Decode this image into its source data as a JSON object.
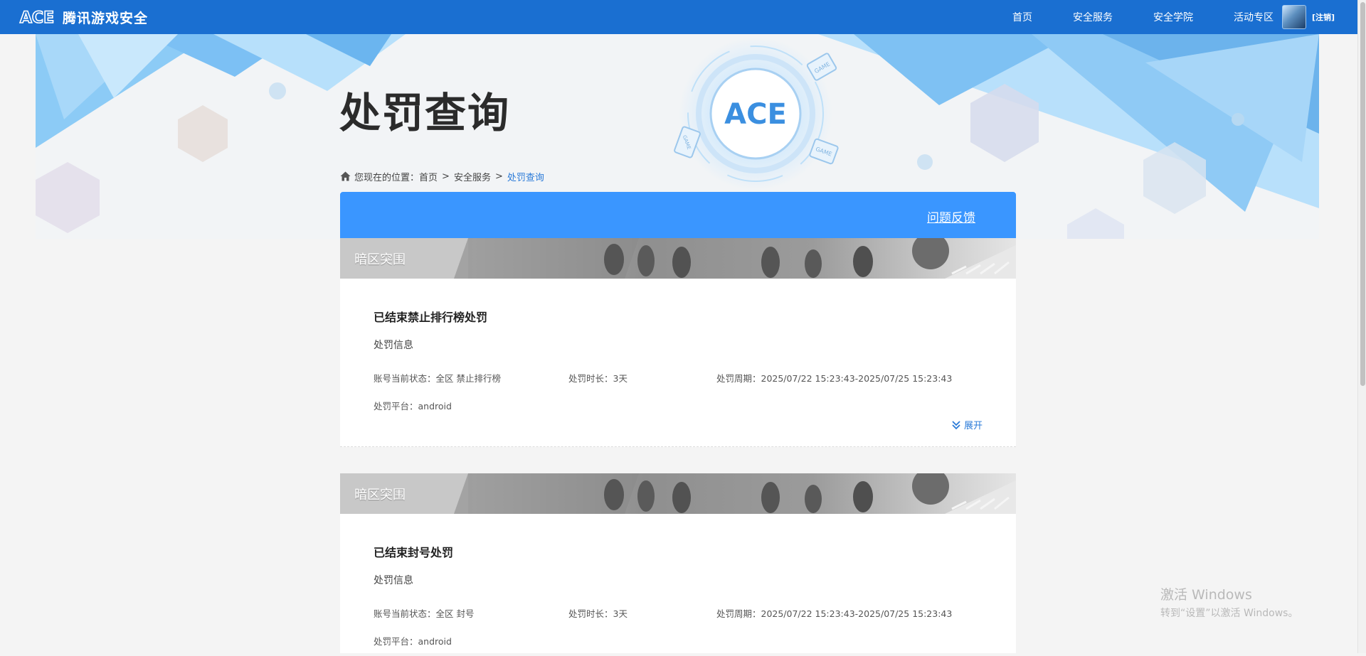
{
  "topbar": {
    "logo_mark": "ACE",
    "logo_text": "腾讯游戏安全",
    "nav": [
      "首页",
      "安全服务",
      "安全学院",
      "活动专区"
    ],
    "logout": "[注销]",
    "bg_color": "#1a6fd1"
  },
  "banner": {
    "emblem_text": "ACE",
    "game_badge": "GAME"
  },
  "page": {
    "title": "处罚查询",
    "breadcrumb": {
      "prefix": "您现在的位置：",
      "items": [
        "首页",
        "安全服务",
        "处罚查询"
      ],
      "separator": ">"
    }
  },
  "panel": {
    "feedback": "问题反馈",
    "header_color": "#3a96ff"
  },
  "records": [
    {
      "game": "暗区突围",
      "title": "已结束禁止排行榜处罚",
      "section": "处罚信息",
      "status": "账号当前状态：全区 禁止排行榜",
      "duration": "处罚时长：3天",
      "period": "处罚周期：2025/07/22 15:23:43-2025/07/25 15:23:43",
      "platform": "处罚平台：android",
      "expand": "展开"
    },
    {
      "game": "暗区突围",
      "title": "已结束封号处罚",
      "section": "处罚信息",
      "status": "账号当前状态：全区 封号",
      "duration": "处罚时长：3天",
      "period": "处罚周期：2025/07/22 15:23:43-2025/07/25 15:23:43",
      "platform": "处罚平台：android"
    }
  ],
  "watermark": {
    "line1": "激活 Windows",
    "line2": "转到“设置”以激活 Windows。"
  }
}
